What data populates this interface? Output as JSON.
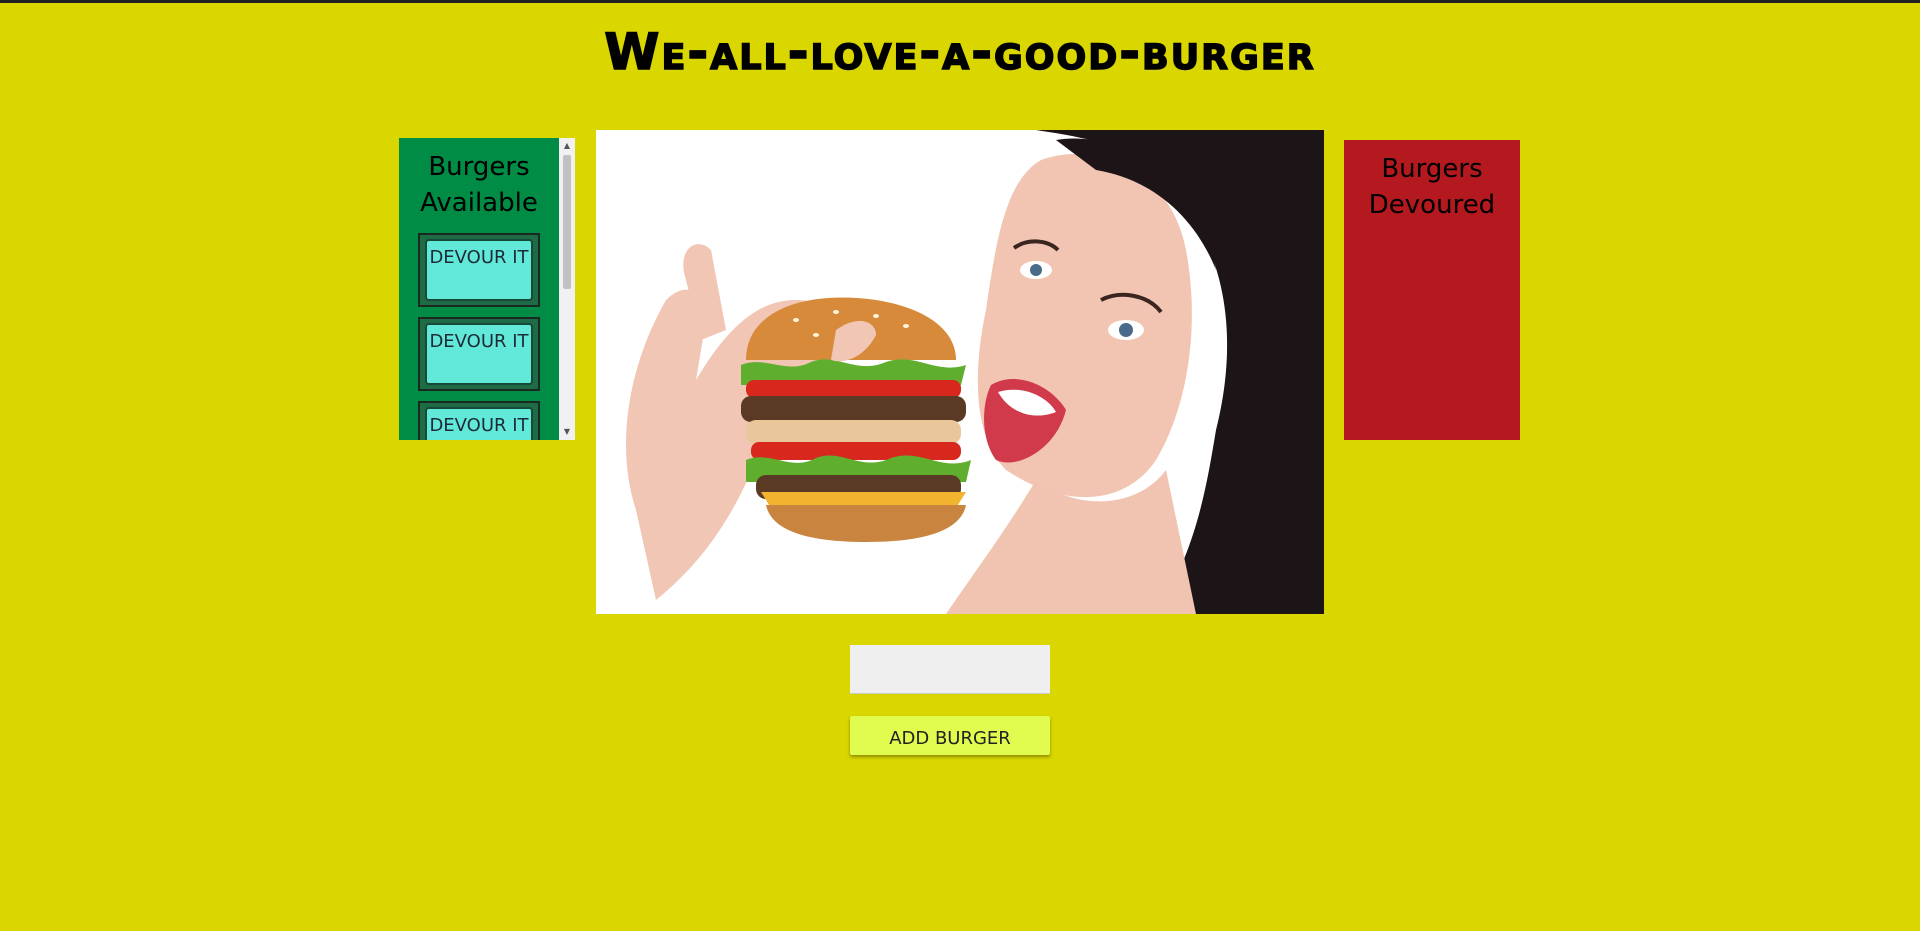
{
  "header": {
    "title": "We-all-love-a-good-burger"
  },
  "available": {
    "heading": "Burgers Available",
    "items": [
      {
        "button_label": "DEVOUR IT"
      },
      {
        "button_label": "DEVOUR IT"
      },
      {
        "button_label": "DEVOUR IT"
      }
    ]
  },
  "devoured": {
    "heading": "Burgers Devoured"
  },
  "form": {
    "input_value": "",
    "add_label": "ADD BURGER"
  },
  "colors": {
    "background": "#d9d600",
    "available_panel": "#008c44",
    "devour_button": "#62e8d8",
    "devoured_panel": "#b3191e",
    "add_button": "#e1fb4f"
  },
  "icons": {
    "scroll_up": "scroll-up-arrow-icon",
    "scroll_down": "scroll-down-arrow-icon"
  }
}
